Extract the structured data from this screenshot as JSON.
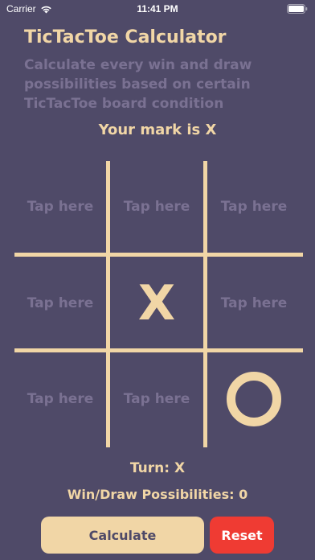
{
  "status_bar": {
    "carrier": "Carrier",
    "time": "11:41 PM",
    "wifi_icon": "wifi-icon",
    "battery_icon": "battery-icon"
  },
  "header": {
    "title": "TicTacToe Calculator",
    "subtitle": "Calculate every win and draw possibilities based on certain TicTacToe board condition"
  },
  "player": {
    "mark_label": "Your mark is X"
  },
  "board": {
    "cells": [
      {
        "mark": "",
        "placeholder": "Tap here"
      },
      {
        "mark": "",
        "placeholder": "Tap here"
      },
      {
        "mark": "",
        "placeholder": "Tap here"
      },
      {
        "mark": "",
        "placeholder": "Tap here"
      },
      {
        "mark": "X",
        "placeholder": ""
      },
      {
        "mark": "",
        "placeholder": "Tap here"
      },
      {
        "mark": "",
        "placeholder": "Tap here"
      },
      {
        "mark": "",
        "placeholder": "Tap here"
      },
      {
        "mark": "O",
        "placeholder": ""
      }
    ]
  },
  "game_status": {
    "turn": "Turn: X",
    "possibilities": "Win/Draw Possibilities: 0"
  },
  "actions": {
    "calculate_label": "Calculate",
    "reset_label": "Reset"
  },
  "colors": {
    "background": "#4f4a68",
    "accent": "#f1d6a6",
    "muted": "#7a7192",
    "danger": "#ef3b33"
  }
}
